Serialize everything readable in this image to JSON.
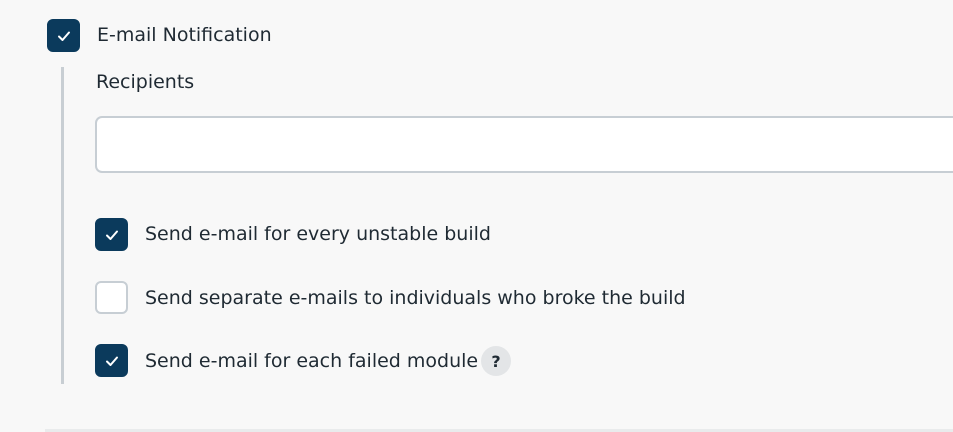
{
  "email_notification": {
    "label": "E-mail Notification",
    "checked": true,
    "recipients": {
      "label": "Recipients",
      "value": "",
      "placeholder": ""
    },
    "options": [
      {
        "label": "Send e-mail for every unstable build",
        "checked": true
      },
      {
        "label": "Send separate e-mails to individuals who broke the build",
        "checked": false
      },
      {
        "label": "Send e-mail for each failed module",
        "checked": true,
        "help_icon": "?"
      }
    ]
  },
  "colors": {
    "checkbox_checked": "#0b3a5c",
    "checkbox_unchecked_border": "#c7ced4",
    "background": "#f8f8f8",
    "indent_bar": "#c8ced3"
  }
}
